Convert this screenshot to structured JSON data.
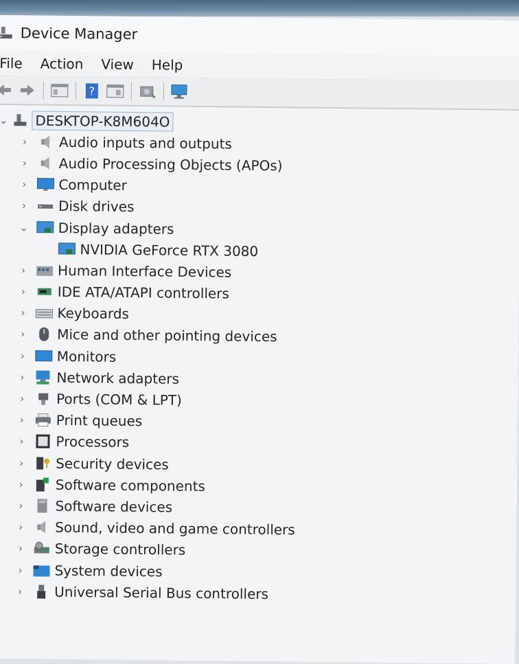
{
  "window": {
    "title": "Device Manager"
  },
  "menu": [
    "File",
    "Action",
    "View",
    "Help"
  ],
  "tree": {
    "root": "DESKTOP-K8M604O",
    "categories": [
      {
        "label": "Audio inputs and outputs",
        "icon": "speaker-icon",
        "expanded": false
      },
      {
        "label": "Audio Processing Objects (APOs)",
        "icon": "speaker-icon",
        "expanded": false
      },
      {
        "label": "Computer",
        "icon": "computer-icon",
        "expanded": false
      },
      {
        "label": "Disk drives",
        "icon": "disk-drive-icon",
        "expanded": false
      },
      {
        "label": "Display adapters",
        "icon": "display-adapter-icon",
        "expanded": true,
        "children": [
          {
            "label": "NVIDIA GeForce RTX 3080",
            "icon": "display-adapter-icon"
          }
        ]
      },
      {
        "label": "Human Interface Devices",
        "icon": "hid-icon",
        "expanded": false
      },
      {
        "label": "IDE ATA/ATAPI controllers",
        "icon": "ide-controller-icon",
        "expanded": false
      },
      {
        "label": "Keyboards",
        "icon": "keyboard-icon",
        "expanded": false
      },
      {
        "label": "Mice and other pointing devices",
        "icon": "mouse-icon",
        "expanded": false
      },
      {
        "label": "Monitors",
        "icon": "monitor-icon",
        "expanded": false
      },
      {
        "label": "Network adapters",
        "icon": "network-adapter-icon",
        "expanded": false
      },
      {
        "label": "Ports (COM & LPT)",
        "icon": "port-icon",
        "expanded": false
      },
      {
        "label": "Print queues",
        "icon": "printer-icon",
        "expanded": false
      },
      {
        "label": "Processors",
        "icon": "processor-icon",
        "expanded": false
      },
      {
        "label": "Security devices",
        "icon": "security-device-icon",
        "expanded": false
      },
      {
        "label": "Software components",
        "icon": "software-component-icon",
        "expanded": false
      },
      {
        "label": "Software devices",
        "icon": "software-device-icon",
        "expanded": false
      },
      {
        "label": "Sound, video and game controllers",
        "icon": "speaker-icon",
        "expanded": false
      },
      {
        "label": "Storage controllers",
        "icon": "storage-controller-icon",
        "expanded": false
      },
      {
        "label": "System devices",
        "icon": "system-device-icon",
        "expanded": false
      },
      {
        "label": "Universal Serial Bus controllers",
        "icon": "usb-icon",
        "expanded": false
      }
    ]
  },
  "colors": {
    "accent": "#2f7fd1",
    "selection_border": "#9ab2cc",
    "selection_bg": "#e9eef4"
  }
}
